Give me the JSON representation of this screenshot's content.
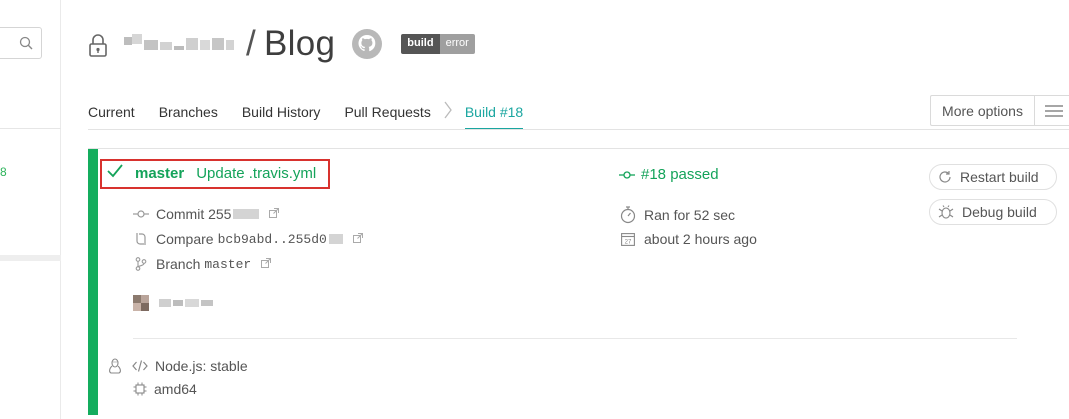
{
  "header": {
    "repo_name": "Blog",
    "badge": {
      "left": "build",
      "right": "error"
    }
  },
  "tabs": [
    {
      "label": "Current"
    },
    {
      "label": "Branches"
    },
    {
      "label": "Build History"
    },
    {
      "label": "Pull Requests"
    },
    {
      "label": "Build #18"
    }
  ],
  "toolbar": {
    "more_options_label": "More options"
  },
  "sidebar": {
    "fragment": "8"
  },
  "build": {
    "branch": "master",
    "message": "Update .travis.yml",
    "commit_label": "Commit 255",
    "compare_label": "Compare",
    "compare_value": "bcb9abd..255d0",
    "branch_label": "Branch",
    "branch_value": "master",
    "status_text": "#18 passed",
    "duration": "Ran for 52 sec",
    "finished": "about 2 hours ago",
    "restart_label": "Restart build",
    "debug_label": "Debug build",
    "language": "Node.js: stable",
    "arch": "amd64"
  },
  "colors": {
    "passed": "#14a35a",
    "active_tab": "#1aa6a0",
    "highlight": "#d8322e"
  }
}
